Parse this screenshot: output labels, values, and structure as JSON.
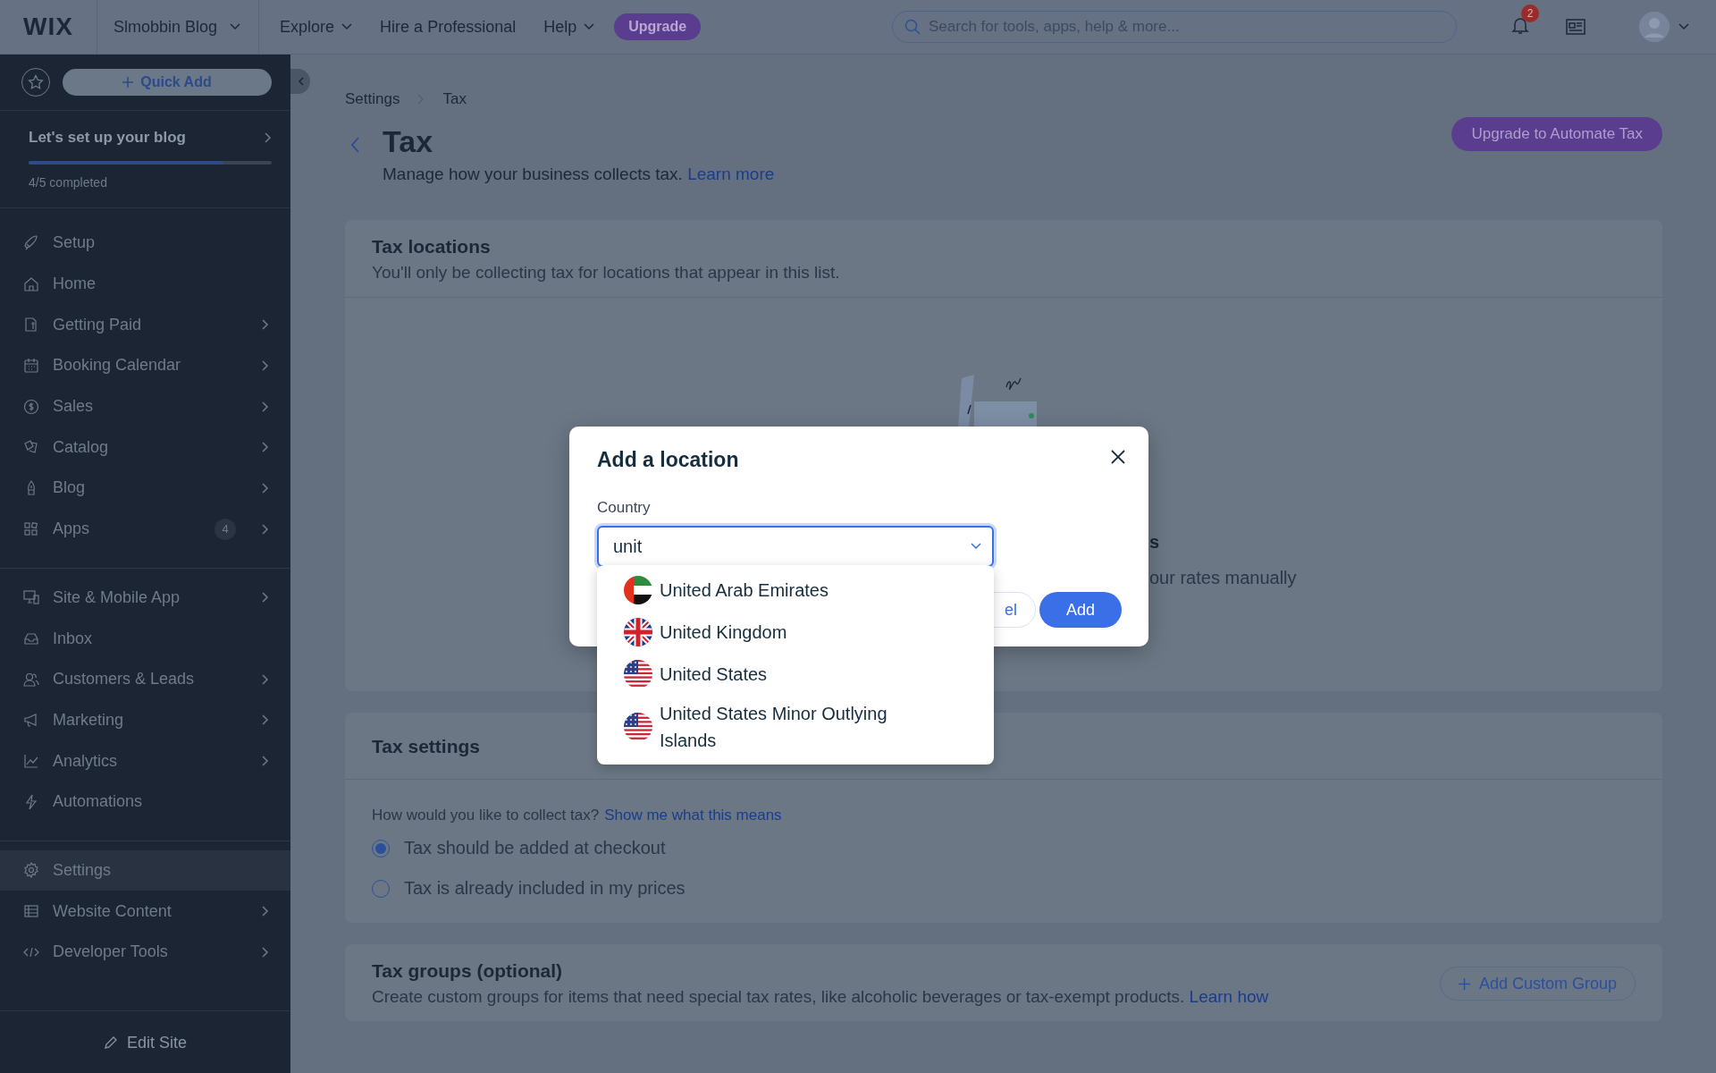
{
  "topbar": {
    "logo": "WIX",
    "site_name": "Slmobbin Blog",
    "nav": [
      {
        "label": "Explore",
        "dropdown": true
      },
      {
        "label": "Hire a Professional",
        "dropdown": false
      },
      {
        "label": "Help",
        "dropdown": true
      }
    ],
    "upgrade": "Upgrade",
    "search": {
      "placeholder": "Search for tools, apps, help & more..."
    },
    "notifications_badge": "2"
  },
  "sidebar": {
    "quick_add": "Quick Add",
    "setup": {
      "title": "Let's set up your blog",
      "level": 0.8,
      "progress_text": "4/5 completed"
    },
    "groups": [
      [
        {
          "label": "Setup",
          "chevron": false,
          "selected": false
        },
        {
          "label": "Home",
          "chevron": false,
          "selected": false
        },
        {
          "label": "Getting Paid",
          "chevron": true,
          "selected": false
        },
        {
          "label": "Booking Calendar",
          "chevron": true,
          "selected": false
        },
        {
          "label": "Sales",
          "chevron": true,
          "selected": false
        },
        {
          "label": "Catalog",
          "chevron": true,
          "selected": false
        },
        {
          "label": "Blog",
          "chevron": true,
          "selected": false
        },
        {
          "label": "Apps",
          "chevron": true,
          "badge": "4",
          "selected": false
        }
      ],
      [
        {
          "label": "Site & Mobile App",
          "chevron": true,
          "selected": false
        },
        {
          "label": "Inbox",
          "chevron": false,
          "selected": false
        },
        {
          "label": "Customers & Leads",
          "chevron": true,
          "selected": false
        },
        {
          "label": "Marketing",
          "chevron": true,
          "selected": false
        },
        {
          "label": "Analytics",
          "chevron": true,
          "selected": false
        },
        {
          "label": "Automations",
          "chevron": false,
          "selected": false
        }
      ],
      [
        {
          "label": "Settings",
          "chevron": false,
          "selected": true
        },
        {
          "label": "Website Content",
          "chevron": true,
          "selected": false
        },
        {
          "label": "Developer Tools",
          "chevron": true,
          "selected": false
        }
      ]
    ],
    "footer": "Edit Site"
  },
  "main": {
    "breadcrumb": [
      "Settings",
      "Tax"
    ],
    "title": "Tax",
    "subtitle": "Manage how your business collects tax.",
    "learn_more": "Learn more",
    "upgrade_button": "Upgrade to Automate Tax",
    "tax_locations": {
      "title": "Tax locations",
      "description": "You'll only be collecting tax for locations that appear in this list.",
      "empty_title": "s",
      "empty_text": "our rates manually"
    },
    "tax_settings": {
      "title": "Tax settings",
      "question": "How would you like to collect tax?",
      "link": "Show me what this means",
      "options": [
        {
          "label": "Tax should be added at checkout",
          "selected": true
        },
        {
          "label": "Tax is already included in my prices",
          "selected": false
        }
      ]
    },
    "tax_groups": {
      "title": "Tax groups (optional)",
      "description": "Create custom groups for items that need special tax rates, like alcoholic beverages or tax-exempt products.",
      "link": "Learn how",
      "button": "Add Custom Group"
    }
  },
  "modal": {
    "title": "Add a location",
    "field_label": "Country",
    "value": "unit",
    "cancel": "el",
    "add": "Add",
    "options": [
      {
        "label": "United Arab Emirates",
        "kind": "uae"
      },
      {
        "label": "United Kingdom",
        "kind": "uk"
      },
      {
        "label": "United States",
        "kind": "us"
      },
      {
        "label": "United States Minor Outlying Islands",
        "kind": "us"
      }
    ]
  }
}
